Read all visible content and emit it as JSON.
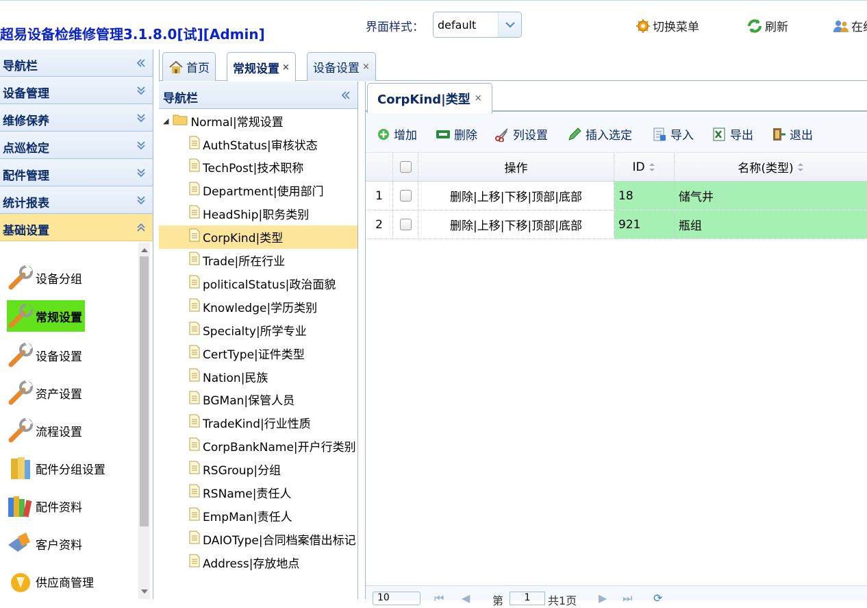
{
  "header": {
    "app_title": "超易设备检维修管理3.1.8.0[试]",
    "admin_label": "[Admin]",
    "style_label": "界面样式：",
    "style_value": "default",
    "switch_menu": "切换菜单",
    "refresh": "刷新",
    "online": "在线"
  },
  "leftnav": {
    "title": "导航栏",
    "sections": [
      {
        "label": "设备管理"
      },
      {
        "label": "维修保养"
      },
      {
        "label": "点巡检定"
      },
      {
        "label": "配件管理"
      },
      {
        "label": "统计报表"
      },
      {
        "label": "基础设置"
      }
    ],
    "entries": [
      {
        "label": "设备分组",
        "icon": "wrench-icon"
      },
      {
        "label": "常规设置",
        "icon": "wrench-icon"
      },
      {
        "label": "设备设置",
        "icon": "wrench-icon"
      },
      {
        "label": "资产设置",
        "icon": "wrench-icon"
      },
      {
        "label": "流程设置",
        "icon": "wrench-icon"
      },
      {
        "label": "配件分组设置",
        "icon": "books-icon"
      },
      {
        "label": "配件资料",
        "icon": "books-icon"
      },
      {
        "label": "客户资料",
        "icon": "customer-icon"
      },
      {
        "label": "供应商管理",
        "icon": "supplier-icon"
      }
    ]
  },
  "outer_tabs": [
    {
      "label": "首页",
      "icon": "home-icon"
    },
    {
      "label": "常规设置",
      "close": "×"
    },
    {
      "label": "设备设置",
      "close": "×"
    }
  ],
  "tree": {
    "title": "导航栏",
    "root": "Normal|常规设置",
    "children": [
      "AuthStatus|审核状态",
      "TechPost|技术职称",
      "Department|使用部门",
      "HeadShip|职务类别",
      "CorpKind|类型",
      "Trade|所在行业",
      "politicalStatus|政治面貌",
      "Knowledge|学历类别",
      "Specialty|所学专业",
      "CertType|证件类型",
      "Nation|民族",
      "BGMan|保管人员",
      "TradeKind|行业性质",
      "CorpBankName|开户行类别",
      "RSGroup|分组",
      "RSName|责任人",
      "EmpMan|责任人",
      "DAIOType|合同档案借出标记",
      "Address|存放地点"
    ]
  },
  "inner_tab": {
    "label": "CorpKind|类型",
    "close": "×"
  },
  "toolbar": {
    "add": "增加",
    "delete": "删除",
    "columns": "列设置",
    "insert": "插入选定",
    "import": "导入",
    "export": "导出",
    "exit": "退出"
  },
  "grid": {
    "columns": {
      "op": "操作",
      "id": "ID",
      "name": "名称(类型)"
    },
    "rows": [
      {
        "num": "1",
        "op": "删除|上移|下移|顶部|底部",
        "id": "18",
        "name": "储气井"
      },
      {
        "num": "2",
        "op": "删除|上移|下移|顶部|底部",
        "id": "921",
        "name": "瓶组"
      }
    ]
  },
  "pager": {
    "page_size": "10",
    "page_prefix": "第",
    "page_value": "1",
    "page_total": "共1页"
  },
  "colors": {
    "accent": "#0b24c9",
    "active_row": "#fde69a",
    "selected_entry": "#63e21c",
    "grid_highlight": "#a6f0b4"
  }
}
